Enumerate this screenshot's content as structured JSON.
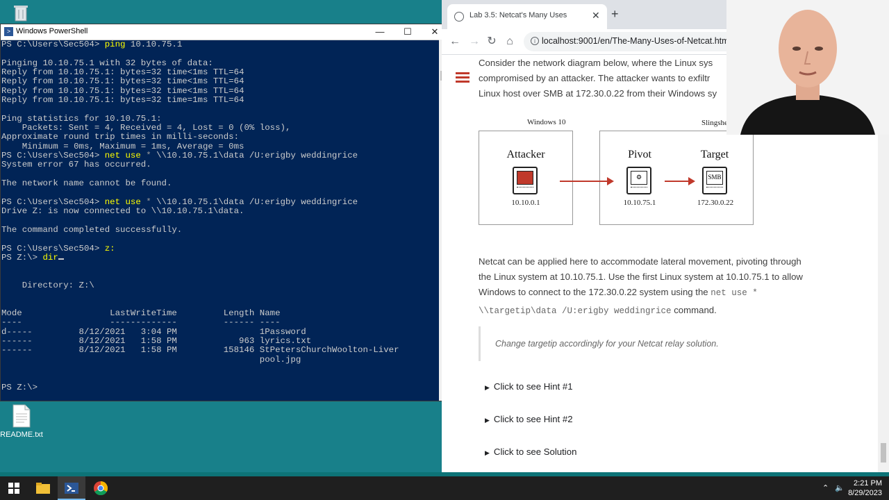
{
  "desktop": {
    "recycle_bin_label": "",
    "readme_label": "README.txt"
  },
  "powershell": {
    "title": "Windows PowerShell",
    "lines": {
      "l1_prompt": "PS C:\\Users\\Sec504> ",
      "l1_cmd": "ping",
      "l1_arg": " 10.10.75.1",
      "l2": "Pinging 10.10.75.1 with 32 bytes of data:",
      "l3": "Reply from 10.10.75.1: bytes=32 time<1ms TTL=64",
      "l4": "Reply from 10.10.75.1: bytes=32 time<1ms TTL=64",
      "l5": "Reply from 10.10.75.1: bytes=32 time<1ms TTL=64",
      "l6": "Reply from 10.10.75.1: bytes=32 time=1ms TTL=64",
      "l7": "Ping statistics for 10.10.75.1:",
      "l8": "    Packets: Sent = 4, Received = 4, Lost = 0 (0% loss),",
      "l9": "Approximate round trip times in milli-seconds:",
      "l10": "    Minimum = 0ms, Maximum = 1ms, Average = 0ms",
      "l11_prompt": "PS C:\\Users\\Sec504> ",
      "l11_cmd": "net use",
      "l11_star": " * ",
      "l11_arg": "\\\\10.10.75.1\\data /U:erigby weddingrice",
      "l12": "System error 67 has occurred.",
      "l13": "The network name cannot be found.",
      "l14_prompt": "PS C:\\Users\\Sec504> ",
      "l14_cmd": "net use",
      "l14_star": " * ",
      "l14_arg": "\\\\10.10.75.1\\data /U:erigby weddingrice",
      "l15": "Drive Z: is now connected to \\\\10.10.75.1\\data.",
      "l16": "The command completed successfully.",
      "l17_prompt": "PS C:\\Users\\Sec504> ",
      "l17_cmd": "z:",
      "l18_prompt": "PS Z:\\> ",
      "l18_cmd": "dir",
      "l19": "    Directory: Z:\\",
      "l20": "Mode                 LastWriteTime         Length Name",
      "l21": "----                 -------------         ------ ----",
      "l22": "d-----         8/12/2021   3:04 PM                1Password",
      "l23": "------         8/12/2021   1:58 PM            963 lyrics.txt",
      "l24": "------         8/12/2021   1:58 PM         158146 StPetersChurchWoolton-Liver",
      "l25": "                                                  pool.jpg",
      "l26_prompt": "PS Z:\\> "
    }
  },
  "browser": {
    "tab_title": "Lab 3.5: Netcat's Many Uses",
    "new_tab": "+",
    "url": "localhost:9001/en/The-Many-Uses-of-Netcat.html",
    "intro": {
      "line1": "Consider the network diagram below, where the Linux sys",
      "line2": "compromised by an attacker. The attacker wants to exfiltr",
      "line3": "Linux host over SMB at 172.30.0.22 from their Windows sy"
    },
    "diagram": {
      "left_label": "Windows 10",
      "right_label": "Slingshe",
      "attacker": {
        "title": "Attacker",
        "ip": "10.10.0.1"
      },
      "pivot": {
        "title": "Pivot",
        "ip": "10.10.75.1"
      },
      "target": {
        "title": "Target",
        "ip": "172.30.0.22",
        "screen_text": "SMB"
      }
    },
    "body": {
      "line1": "Netcat can be applied here to accommodate lateral movement, pivoting through",
      "line2": "the Linux system at 10.10.75.1. Use the first Linux system at 10.10.75.1 to allow",
      "line3a": "Windows to connect to the 172.30.0.22 system using the ",
      "line3_code": "net use *",
      "line4_code": "\\\\targetip\\data /U:erigby weddingrice",
      "line4b": " command."
    },
    "note": "Change targetip accordingly for your Netcat relay solution.",
    "details": [
      {
        "label": "Click to see Hint #1"
      },
      {
        "label": "Click to see Hint #2"
      },
      {
        "label": "Click to see Solution"
      }
    ]
  },
  "taskbar": {
    "time": "2:21 PM",
    "date": "8/29/2023"
  },
  "colors": {
    "ps_background": "#012456",
    "ps_command": "#ffff00",
    "accent_red": "#c0392b"
  }
}
